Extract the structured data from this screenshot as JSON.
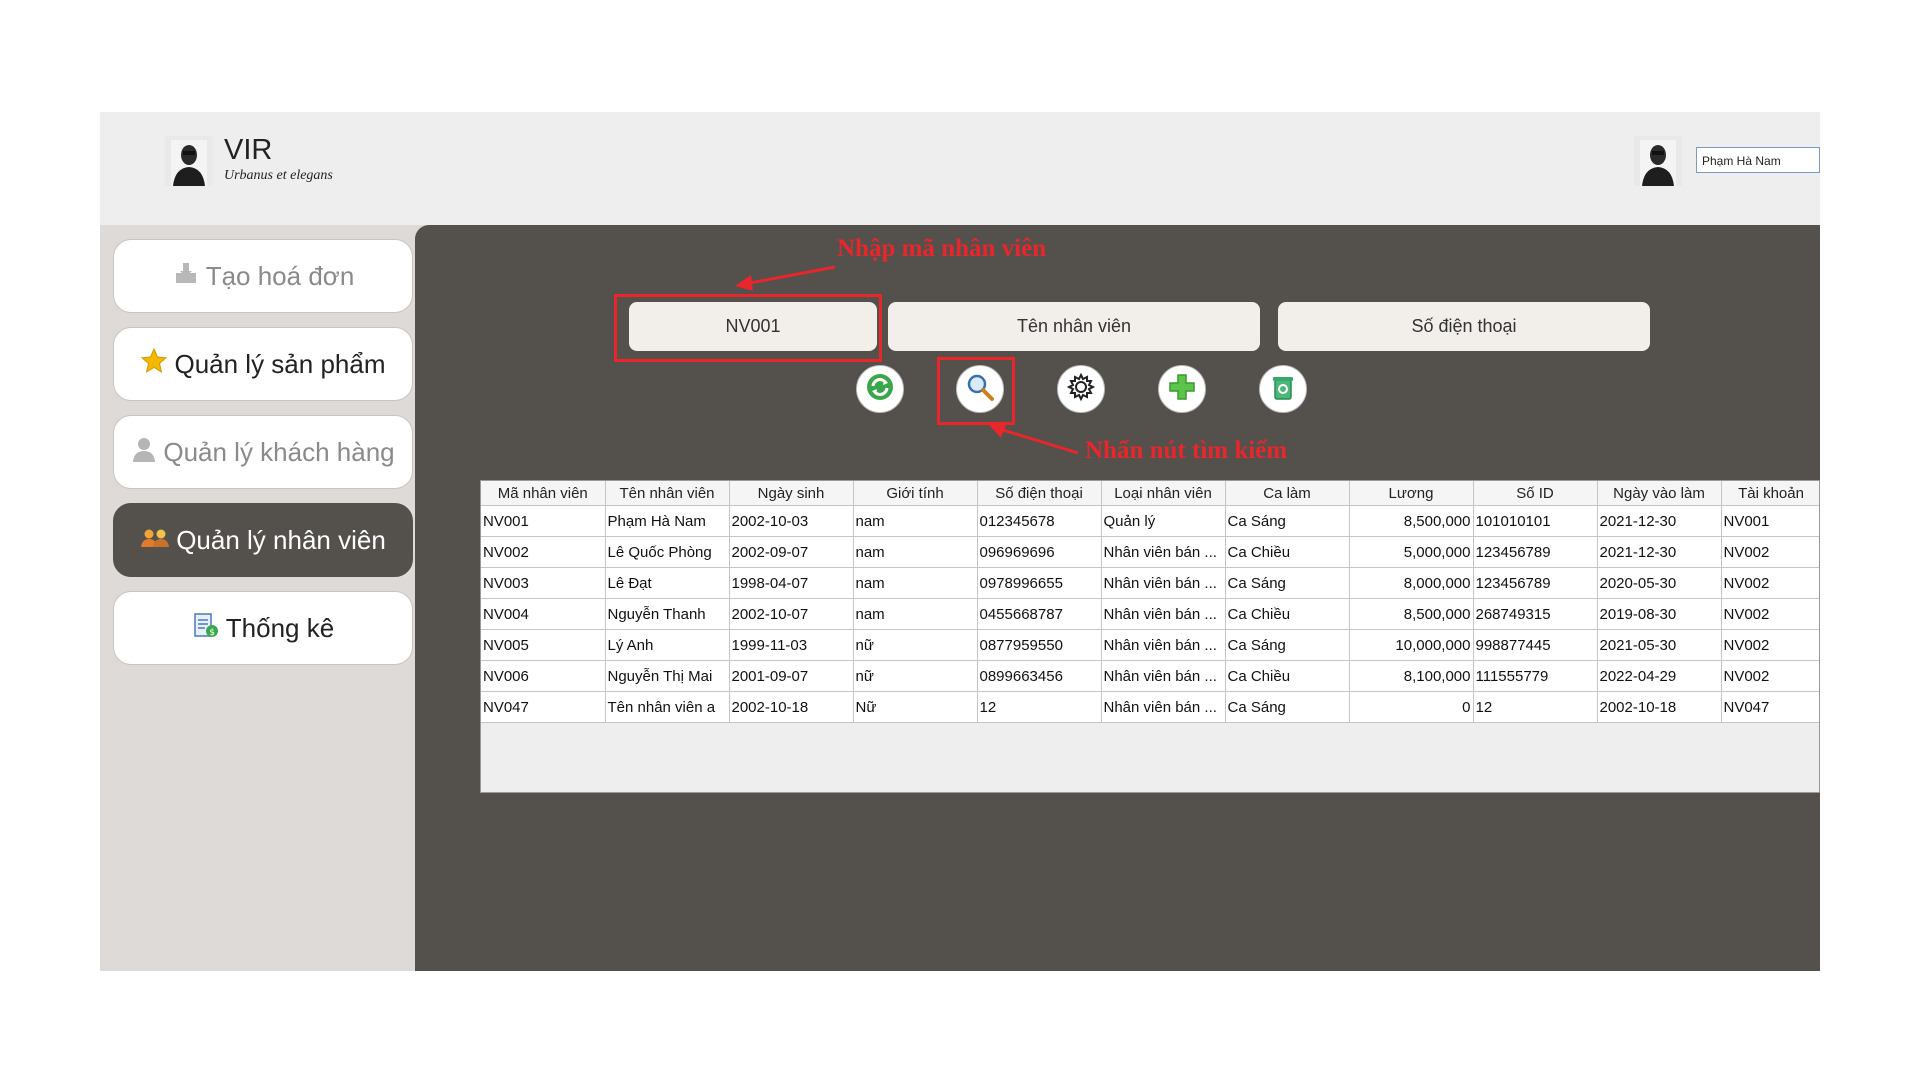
{
  "header": {
    "brand_title": "VIR",
    "brand_subtitle": "Urbanus et elegans",
    "user_name": "Phạm Hà Nam"
  },
  "sidebar": {
    "items": [
      {
        "label": "Tạo hoá đơn",
        "icon": "cart-icon"
      },
      {
        "label": "Quản lý sản phẩm",
        "icon": "star-icon"
      },
      {
        "label": "Quản lý khách hàng",
        "icon": "person-icon"
      },
      {
        "label": "Quản lý nhân viên",
        "icon": "people-icon"
      },
      {
        "label": "Thống kê",
        "icon": "report-icon"
      }
    ]
  },
  "search": {
    "employee_id_value": "NV001",
    "employee_name_placeholder": "Tên nhân viên",
    "phone_placeholder": "Số điện thoại"
  },
  "toolbar": {
    "icons": [
      "refresh-icon",
      "search-icon",
      "settings-icon",
      "add-icon",
      "delete-icon"
    ]
  },
  "annotations": {
    "enter_id": "Nhập mã nhân viên",
    "press_search": "Nhấn nút tìm kiếm"
  },
  "table": {
    "headers": [
      "Mã nhân viên",
      "Tên nhân viên",
      "Ngày sinh",
      "Giới tính",
      "Số điện thoại",
      "Loại nhân viên",
      "Ca làm",
      "Lương",
      "Số ID",
      "Ngày vào làm",
      "Tài khoản"
    ],
    "rows": [
      [
        "NV001",
        "Phạm Hà Nam",
        "2002-10-03",
        "nam",
        "012345678",
        "Quản lý",
        "Ca Sáng",
        "8,500,000",
        "101010101",
        "2021-12-30",
        "NV001"
      ],
      [
        "NV002",
        "Lê Quốc Phòng",
        "2002-09-07",
        "nam",
        "096969696",
        "Nhân viên bán ...",
        "Ca Chiều",
        "5,000,000",
        "123456789",
        "2021-12-30",
        "NV002"
      ],
      [
        "NV003",
        "Lê Đạt",
        "1998-04-07",
        "nam",
        "0978996655",
        "Nhân viên bán ...",
        "Ca Sáng",
        "8,000,000",
        "123456789",
        "2020-05-30",
        "NV002"
      ],
      [
        "NV004",
        "Nguyễn Thanh",
        "2002-10-07",
        "nam",
        "0455668787",
        "Nhân viên bán ...",
        "Ca Chiều",
        "8,500,000",
        "268749315",
        "2019-08-30",
        "NV002"
      ],
      [
        "NV005",
        "Lý Anh",
        "1999-11-03",
        "nữ",
        "0877959550",
        "Nhân viên bán ...",
        "Ca Sáng",
        "10,000,000",
        "998877445",
        "2021-05-30",
        "NV002"
      ],
      [
        "NV006",
        "Nguyễn Thị Mai",
        "2001-09-07",
        "nữ",
        "0899663456",
        "Nhân viên bán ...",
        "Ca Chiều",
        "8,100,000",
        "111555779",
        "2022-04-29",
        "NV002"
      ],
      [
        "NV047",
        "Tên nhân viên a",
        "2002-10-18",
        "Nữ",
        "12",
        "Nhân viên bán ...",
        "Ca Sáng",
        "0",
        "12",
        "2002-10-18",
        "NV047"
      ]
    ]
  }
}
